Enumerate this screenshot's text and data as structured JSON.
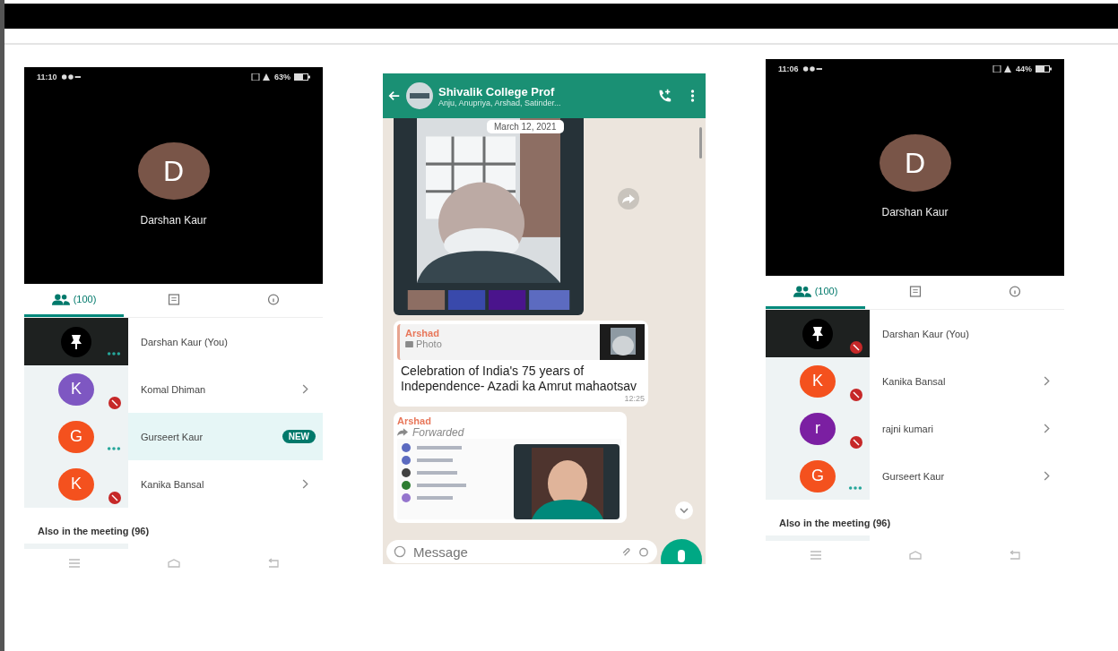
{
  "meetings": [
    {
      "status_time": "11:10",
      "battery": "63%",
      "speaker": {
        "letter": "D",
        "name": "Darshan Kaur"
      },
      "tabs": [
        {
          "kind": "people",
          "label": "(100)",
          "selected": true
        },
        {
          "kind": "chat",
          "selected": false
        },
        {
          "kind": "info",
          "selected": false
        }
      ],
      "participants": [
        {
          "kind": "self",
          "name": "Darshan Kaur (You)",
          "muted": false,
          "speaking": true,
          "selected": false
        },
        {
          "kind": "member",
          "letter": "K",
          "color": "#7e57c2",
          "name": "Komal Dhiman",
          "muted": true,
          "speaking": false,
          "selected": false
        },
        {
          "kind": "member",
          "letter": "G",
          "color": "#f4511e",
          "name": "Gurseert Kaur",
          "muted": false,
          "speaking": true,
          "badge": "NEW",
          "selected": true
        },
        {
          "kind": "member",
          "letter": "K",
          "color": "#f4511e",
          "name": "Kanika Bansal",
          "muted": true,
          "speaking": false,
          "selected": false
        }
      ],
      "also_label": "Also in the meeting (96)"
    },
    {
      "status_time": "11:06",
      "battery": "44%",
      "speaker": {
        "letter": "D",
        "name": "Darshan Kaur"
      },
      "tabs": [
        {
          "kind": "people",
          "label": "(100)",
          "selected": true
        },
        {
          "kind": "chat",
          "selected": false
        },
        {
          "kind": "info",
          "selected": false
        }
      ],
      "participants": [
        {
          "kind": "self",
          "name": "Darshan Kaur (You)",
          "muted": true,
          "speaking": false,
          "selected": false
        },
        {
          "kind": "member",
          "letter": "K",
          "color": "#f4511e",
          "name": "Kanika Bansal",
          "muted": true,
          "speaking": false,
          "selected": false
        },
        {
          "kind": "member",
          "letter": "r",
          "color": "#7b1fa2",
          "name": "rajni kumari",
          "muted": true,
          "speaking": false,
          "selected": false
        },
        {
          "kind": "member",
          "letter": "G",
          "color": "#f4511e",
          "name": "Gurseert Kaur",
          "muted": false,
          "speaking": true,
          "selected": false
        }
      ],
      "also_label": "Also in the meeting (96)"
    }
  ],
  "chat": {
    "title": "Shivalik College Prof",
    "subtitle": "Anju, Anupriya, Arshad, Satinder...",
    "date": "March 12, 2021",
    "messages": [
      {
        "kind": "album"
      },
      {
        "kind": "reply",
        "quote_author": "Arshad",
        "quote_type": "Photo",
        "text": "Celebration of India's 75 years of Independence- Azadi ka Amrut mahaotsav",
        "time": "12:25"
      },
      {
        "kind": "forwarded",
        "author": "Arshad",
        "label": "Forwarded"
      }
    ],
    "input_placeholder": "Message"
  }
}
